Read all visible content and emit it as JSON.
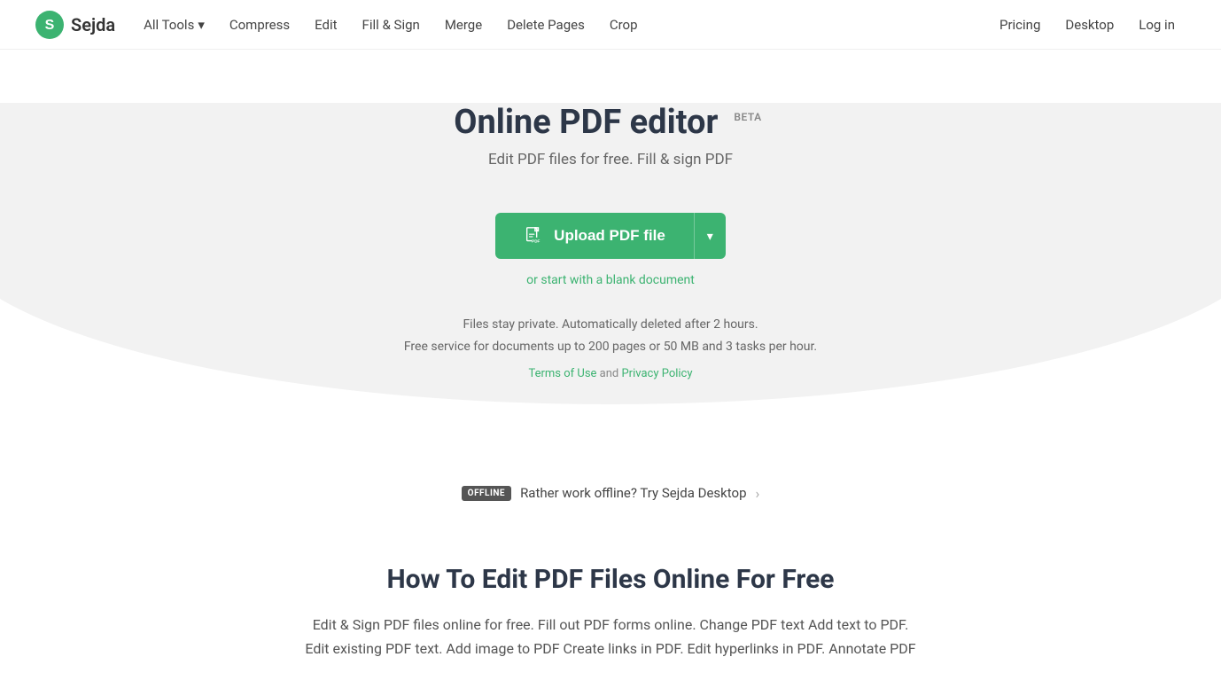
{
  "header": {
    "logo_text": "Sejda",
    "nav_left": [
      {
        "label": "All Tools",
        "has_dropdown": true
      },
      {
        "label": "Compress"
      },
      {
        "label": "Edit"
      },
      {
        "label": "Fill & Sign"
      },
      {
        "label": "Merge"
      },
      {
        "label": "Delete Pages"
      },
      {
        "label": "Crop"
      }
    ],
    "nav_right": [
      {
        "label": "Pricing"
      },
      {
        "label": "Desktop"
      },
      {
        "label": "Log in"
      }
    ]
  },
  "hero": {
    "title": "Online PDF editor",
    "beta": "BETA",
    "subtitle": "Edit PDF files for free. Fill & sign PDF",
    "upload_btn_label": "Upload PDF file",
    "blank_doc_label": "or start with a blank document",
    "info_line1": "Files stay private. Automatically deleted after 2 hours.",
    "info_line2": "Free service for documents up to 200 pages or 50 MB and 3 tasks per hour.",
    "terms_text": "Terms of Use",
    "and_text": "and",
    "privacy_text": "Privacy Policy"
  },
  "offline_banner": {
    "badge": "OFFLINE",
    "text": "Rather work offline? Try Sejda Desktop"
  },
  "bottom": {
    "title": "How To Edit PDF Files Online For Free",
    "description": "Edit & Sign PDF files online for free. Fill out PDF forms online. Change PDF text Add text to PDF. Edit existing PDF text. Add image to PDF Create links in PDF. Edit hyperlinks in PDF. Annotate PDF"
  },
  "colors": {
    "green": "#3cb371",
    "dark_text": "#2d3748",
    "mid_text": "#555",
    "light_text": "#888"
  }
}
